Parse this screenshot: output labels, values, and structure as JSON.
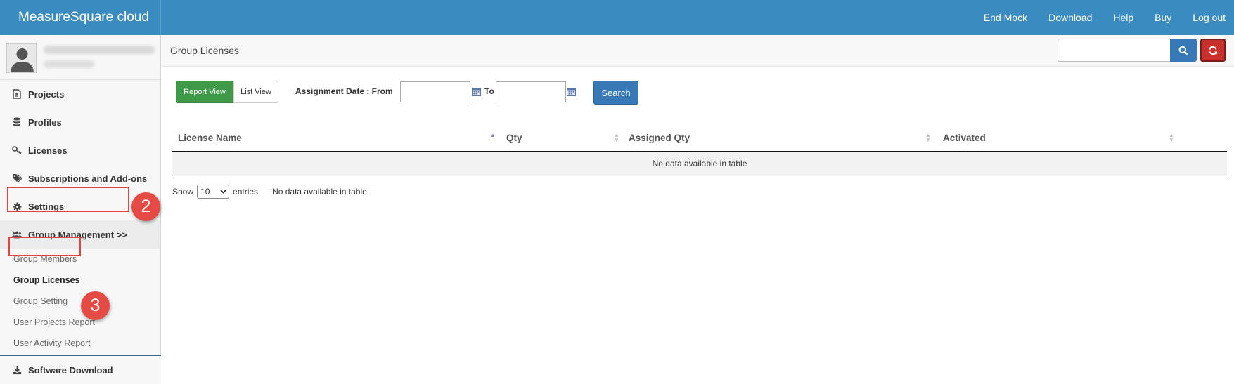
{
  "app": {
    "brand": "MeasureSquare cloud"
  },
  "topnav": [
    "End Mock",
    "Download",
    "Help",
    "Buy",
    "Log out"
  ],
  "sidebar": {
    "items": [
      {
        "label": "Projects",
        "icon": "file-icon"
      },
      {
        "label": "Profiles",
        "icon": "database-icon"
      },
      {
        "label": "Licenses",
        "icon": "key-icon"
      },
      {
        "label": "Subscriptions and Add-ons",
        "icon": "tags-icon"
      },
      {
        "label": "Settings",
        "icon": "gear-icon"
      },
      {
        "label": "Group Management >>",
        "icon": "users-icon"
      }
    ],
    "sub_items": [
      "Group Members",
      "Group Licenses",
      "Group Setting",
      "User Projects Report",
      "User Activity Report"
    ],
    "bottom": {
      "label": "Software Download",
      "icon": "download-icon"
    },
    "annotations": [
      "2",
      "3"
    ]
  },
  "header": {
    "title": "Group Licenses",
    "search_value": ""
  },
  "filters": {
    "report_view": "Report View",
    "list_view": "List View",
    "from_label": "Assignment Date : From",
    "to_label": "To",
    "from_value": "",
    "to_value": "",
    "search_label": "Search"
  },
  "table": {
    "columns": [
      "License Name",
      "Qty",
      "Assigned Qty",
      "Activated"
    ],
    "empty_message": "No data available in table"
  },
  "footer": {
    "show_label": "Show",
    "page_size": "10",
    "entries_label": "entries",
    "info": "No data available in table"
  },
  "colors": {
    "topbar": "#3a8bbf",
    "primary": "#3779b6",
    "success": "#3e9a48",
    "danger": "#c9302c",
    "annotation": "#e54a44"
  }
}
